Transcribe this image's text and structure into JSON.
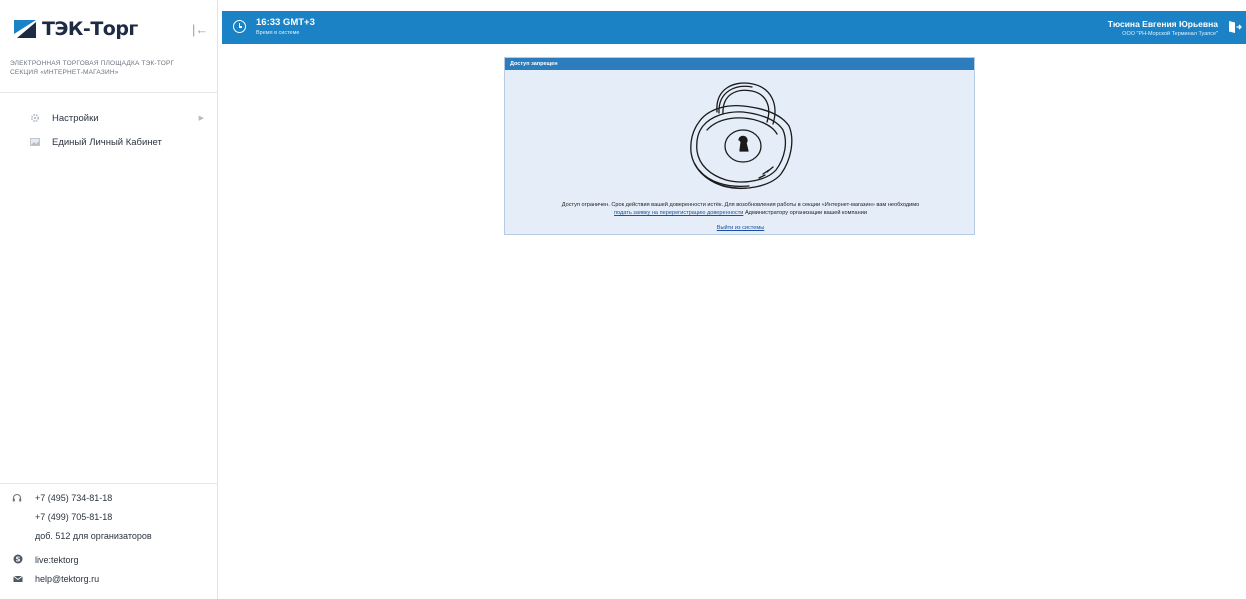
{
  "sidebar": {
    "logo_text": "ТЭК-Торг",
    "subtitle_line1": "ЭЛЕКТРОННАЯ ТОРГОВАЯ ПЛОЩАДКА ТЭК-ТОРГ",
    "subtitle_line2": "СЕКЦИЯ «ИНТЕРНЕТ-МАГАЗИН»",
    "collapse_icon": "collapse-left-icon",
    "menu": [
      {
        "label": "Настройки",
        "icon": "gear-icon",
        "has_submenu": true
      },
      {
        "label": "Единый Личный Кабинет",
        "icon": "cabinet-icon",
        "has_submenu": false
      }
    ],
    "contacts": {
      "phone1": "+7 (495) 734-81-18",
      "phone2": "+7 (499) 705-81-18",
      "ext": "доб. 512 для организаторов",
      "skype": "live:tektorg",
      "email": "help@tektorg.ru"
    }
  },
  "header": {
    "time": "16:33 GMT+3",
    "time_label": "Время в системе",
    "user_name": "Тюсина Евгения Юрьевна",
    "user_org": "ООО \"РН-Морской Терминал Туапсе\"",
    "accent_color": "#1b82c5"
  },
  "dialog": {
    "title": "Доступ запрещен",
    "message_part1": "Доступ ограничен. Срок действия вашей доверенности истёк. Для возобновления работы в секции «Интернет-магазин» вам необходимо",
    "message_link": "подать заявку на перерегистрацию доверенности",
    "message_part2": " Администратору организации вашей компании",
    "logout_link": "Выйти из системы"
  }
}
